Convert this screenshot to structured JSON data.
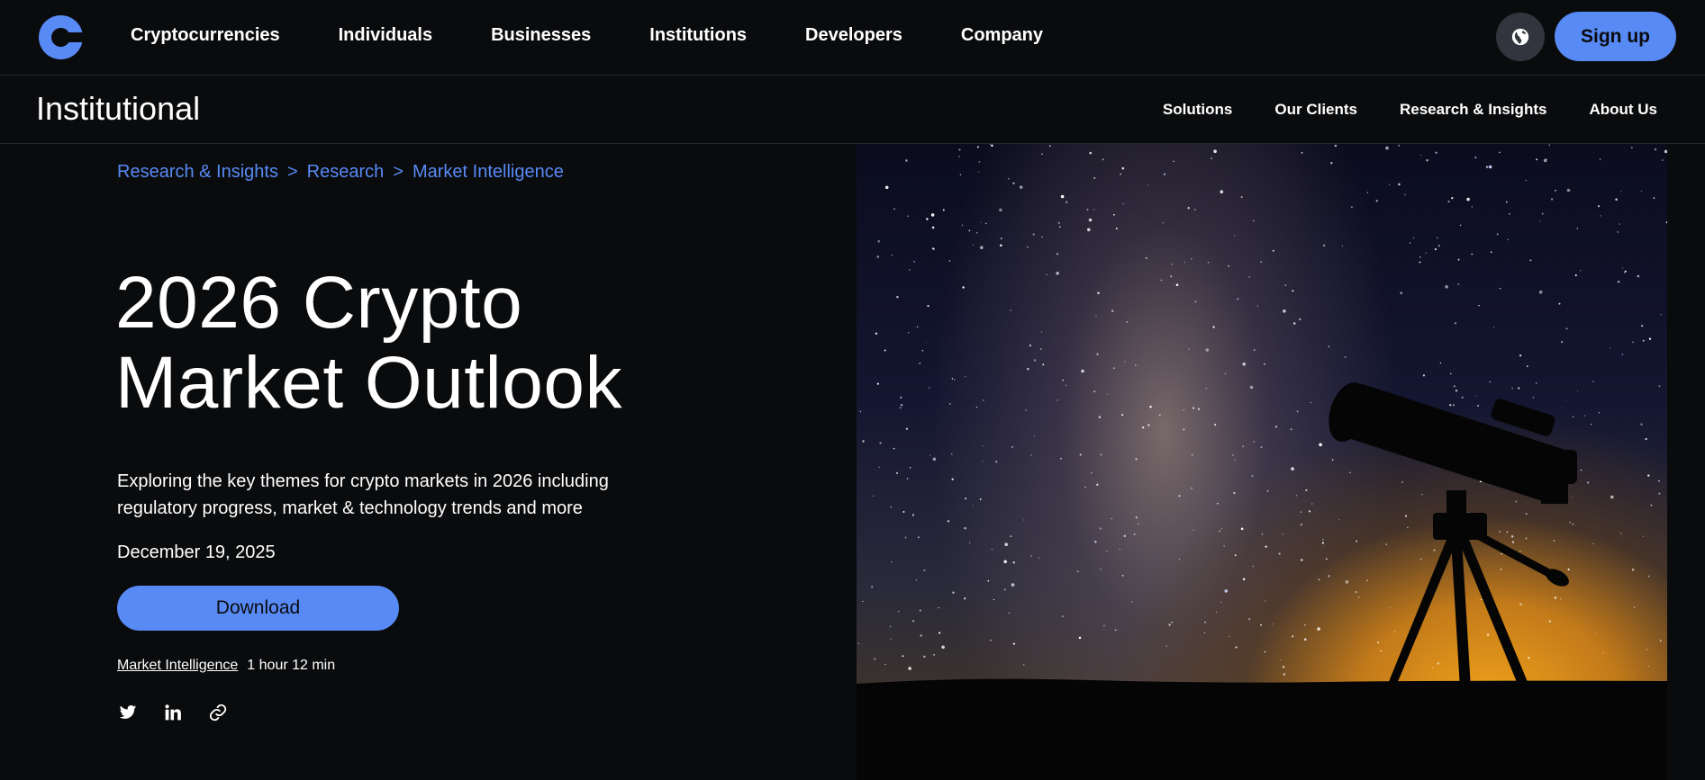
{
  "topnav": {
    "links": [
      "Cryptocurrencies",
      "Individuals",
      "Businesses",
      "Institutions",
      "Developers",
      "Company"
    ],
    "signup_label": "Sign up",
    "logo_icon": "coinbase-logo-icon",
    "globe_icon": "globe-icon"
  },
  "subnav": {
    "title": "Institutional",
    "links": [
      "Solutions",
      "Our Clients",
      "Research & Insights",
      "About Us"
    ]
  },
  "breadcrumb": {
    "items": [
      "Research & Insights",
      "Research",
      "Market Intelligence"
    ],
    "separator": ">"
  },
  "hero": {
    "title_line1": "2026 Crypto",
    "title_line2": "Market Outlook",
    "description": "Exploring the key themes for crypto markets in 2026 including regulatory progress, market & technology trends and more",
    "date": "December 19, 2025",
    "download_label": "Download",
    "tag": "Market Intelligence",
    "read_time": "1 hour 12 min"
  },
  "share": {
    "icons": [
      "twitter-icon",
      "linkedin-icon",
      "link-icon"
    ]
  },
  "colors": {
    "accent": "#588af5",
    "background": "#0a0b0d",
    "globe_button": "#32353d"
  }
}
